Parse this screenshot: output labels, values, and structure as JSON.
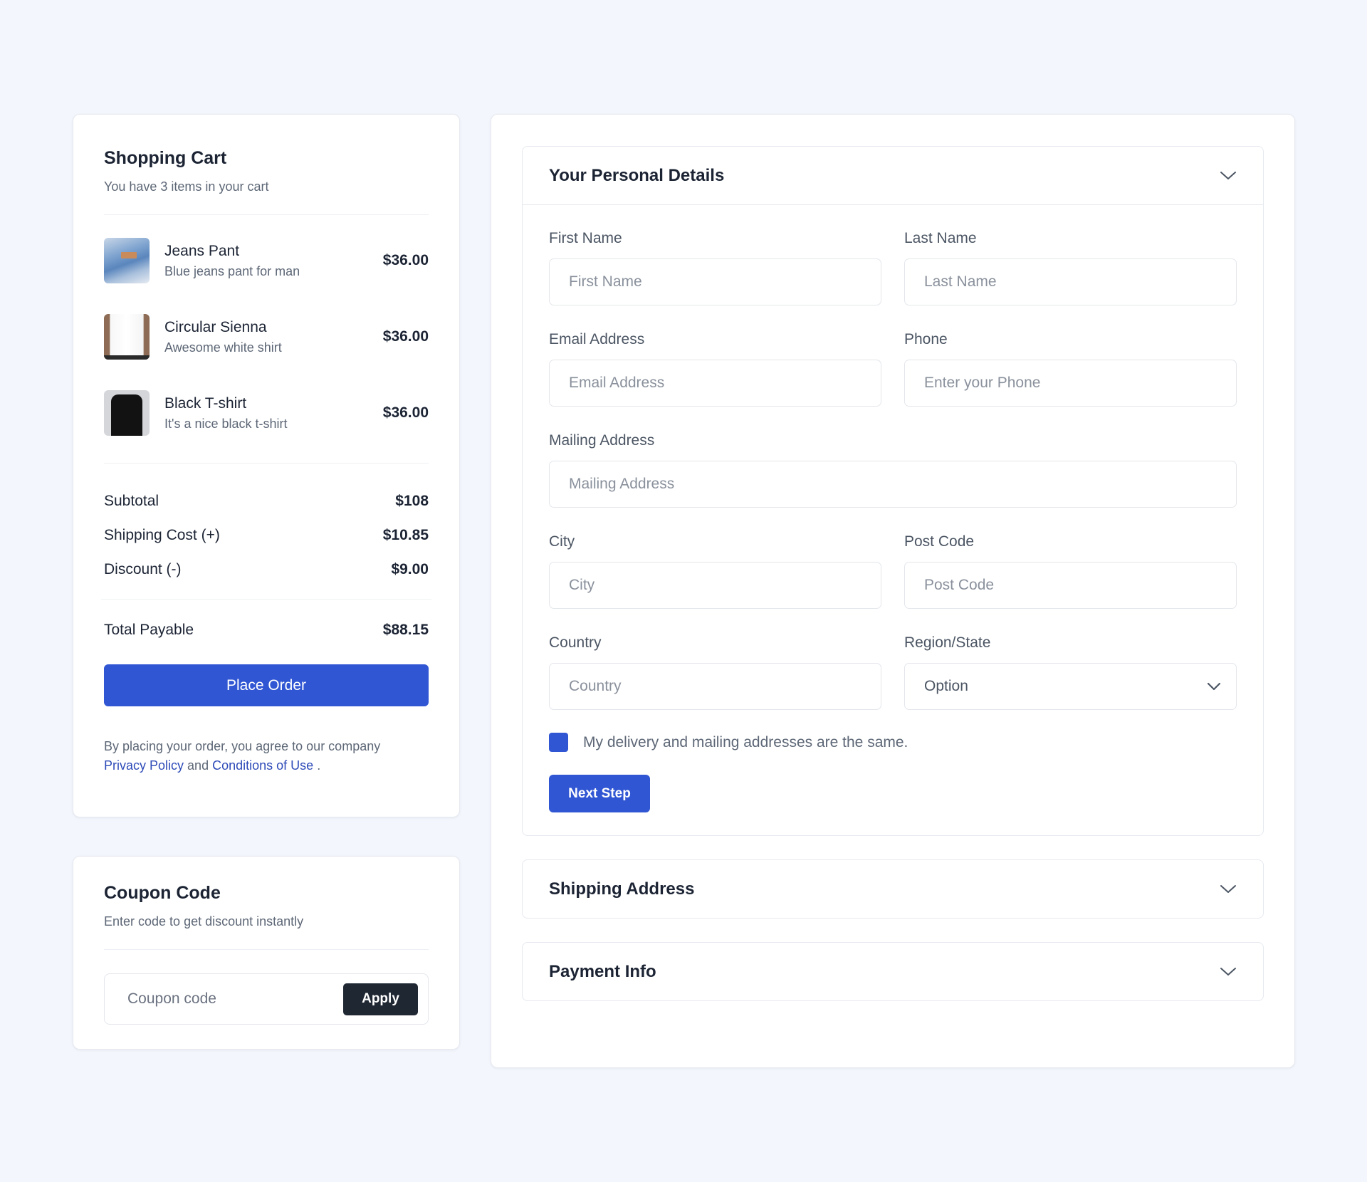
{
  "cart": {
    "title": "Shopping Cart",
    "subtitle": "You have 3 items in your cart",
    "items": [
      {
        "name": "Jeans Pant",
        "description": "Blue jeans pant for man",
        "price": "$36.00",
        "image": "jeans-pant-image"
      },
      {
        "name": "Circular Sienna",
        "description": "Awesome white shirt",
        "price": "$36.00",
        "image": "white-shirt-image"
      },
      {
        "name": "Black T-shirt",
        "description": "It's a nice black t-shirt",
        "price": "$36.00",
        "image": "black-tshirt-image"
      }
    ],
    "summary": [
      {
        "label": "Subtotal",
        "value": "$108"
      },
      {
        "label": "Shipping Cost (+)",
        "value": "$10.85"
      },
      {
        "label": "Discount (-)",
        "value": "$9.00"
      }
    ],
    "total": {
      "label": "Total Payable",
      "value": "$88.15"
    },
    "place_order_label": "Place Order",
    "terms": {
      "prefix": "By placing your order, you agree to our company",
      "privacy_link": "Privacy Policy",
      "and": "and",
      "conditions_link": "Conditions of Use",
      "suffix": "."
    }
  },
  "coupon": {
    "title": "Coupon Code",
    "subtitle": "Enter code to get discount instantly",
    "input_placeholder": "Coupon code",
    "input_value": "",
    "apply_label": "Apply"
  },
  "checkout": {
    "personal_details": {
      "title": "Your Personal Details",
      "expanded": true,
      "fields": {
        "first_name": {
          "label": "First Name",
          "placeholder": "First Name",
          "value": ""
        },
        "last_name": {
          "label": "Last Name",
          "placeholder": "Last Name",
          "value": ""
        },
        "email": {
          "label": "Email Address",
          "placeholder": "Email Address",
          "value": ""
        },
        "phone": {
          "label": "Phone",
          "placeholder": "Enter your Phone",
          "value": ""
        },
        "mailing_address": {
          "label": "Mailing Address",
          "placeholder": "Mailing Address",
          "value": ""
        },
        "city": {
          "label": "City",
          "placeholder": "City",
          "value": ""
        },
        "post_code": {
          "label": "Post Code",
          "placeholder": "Post Code",
          "value": ""
        },
        "country": {
          "label": "Country",
          "placeholder": "Country",
          "value": ""
        },
        "region": {
          "label": "Region/State",
          "selected": "Option"
        }
      },
      "same_address_checkbox": {
        "label": "My delivery and mailing addresses are the same.",
        "checked": true
      },
      "next_step_label": "Next Step"
    },
    "shipping_address": {
      "title": "Shipping Address",
      "expanded": false
    },
    "payment_info": {
      "title": "Payment Info",
      "expanded": false
    }
  },
  "icons": {
    "accordion_toggle": "chevron-down-icon",
    "select_toggle": "chevron-down-icon"
  },
  "colors": {
    "accent": "#3056d3",
    "background": "#f3f6fc",
    "dark_button": "#1f2733",
    "link": "#2e4bb8"
  }
}
